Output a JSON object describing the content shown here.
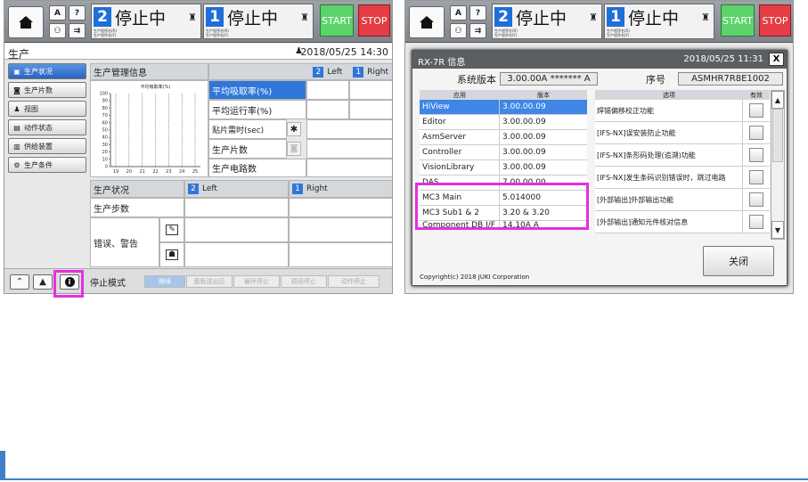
{
  "topbar": {
    "lane2_num": "2",
    "lane2_status": "停止中",
    "lane1_num": "1",
    "lane1_status": "停止中",
    "sub_line1": "生产程序名(R)",
    "sub_line2": "生产程序名(F)",
    "start_label": "START",
    "stop_label": "STOP",
    "btn_a": "A",
    "btn_q": "?"
  },
  "left_screen": {
    "title": "生产",
    "datetime": "2018/05/25 14:30",
    "sidebar": [
      "生产状况",
      "生产片数",
      "视图",
      "动作状态",
      "供给装置",
      "生产条件"
    ],
    "mgmt_title": "生产管理信息",
    "chart_title": "平均吸取率(%)",
    "lane2_label": "Left",
    "lane1_label": "Right",
    "rows": [
      "平均吸取率(%)",
      "平均运行率(%)",
      "贴片需时(sec)",
      "生产片数",
      "生产电路数"
    ],
    "status_title": "生产状况",
    "status_left": "Left",
    "status_right": "Right",
    "steps": "生产步数",
    "error": "错误、警告",
    "stop_mode": "停止模式",
    "modes": [
      "继续",
      "基板送出后",
      "循环停止",
      "路径停止",
      "动作停止"
    ]
  },
  "chart_data": {
    "type": "line",
    "title": "平均吸取率(%)",
    "x": [
      19,
      20,
      21,
      22,
      23,
      24,
      25
    ],
    "ylim": [
      0,
      100
    ],
    "yticks": [
      0,
      10,
      20,
      30,
      40,
      50,
      60,
      70,
      80,
      90,
      100
    ],
    "series": []
  },
  "dialog": {
    "title": "RX-7R 信息",
    "datetime": "2018/05/25 11:31",
    "close_x": "X",
    "sysver_label": "系统版本",
    "sysver_value": "3.00.00A ******* A",
    "serial_label": "序号",
    "serial_value": "ASMHR7R8E1002",
    "app_header": [
      "应用",
      "版本"
    ],
    "apps": [
      [
        "HiView",
        "3.00.00.09"
      ],
      [
        "Editor",
        "3.00.00.09"
      ],
      [
        "AsmServer",
        "3.00.00.09"
      ],
      [
        "Controller",
        "3.00.00.09"
      ],
      [
        "VisionLibrary",
        "3.00.00.09"
      ],
      [
        "DAS",
        "7.00.00.00"
      ],
      [
        "MC3 Main",
        "5.014000"
      ],
      [
        "MC3 Sub1 & 2",
        "3.20 & 3.20"
      ],
      [
        "Component DB I/F",
        "14.10A       A"
      ]
    ],
    "opt_header": [
      "选项",
      "有效"
    ],
    "options": [
      "焊锡偏移校正功能",
      "[IFS-NX]误安装防止功能",
      "[IFS-NX]条形码处理(追溯)功能",
      "[IFS-NX]发生条码识别错误时，跳过电路",
      "[外部输出]外部输出功能",
      "[外部输出]通知元件核对信息"
    ],
    "close_label": "关闭",
    "copyright": "Copyright(c) 2018 JUKI Corporation"
  },
  "colors": {
    "accent": "#2f76d8",
    "highlight": "#e62fe0",
    "start": "#5cd36a",
    "stop": "#e43d46"
  }
}
